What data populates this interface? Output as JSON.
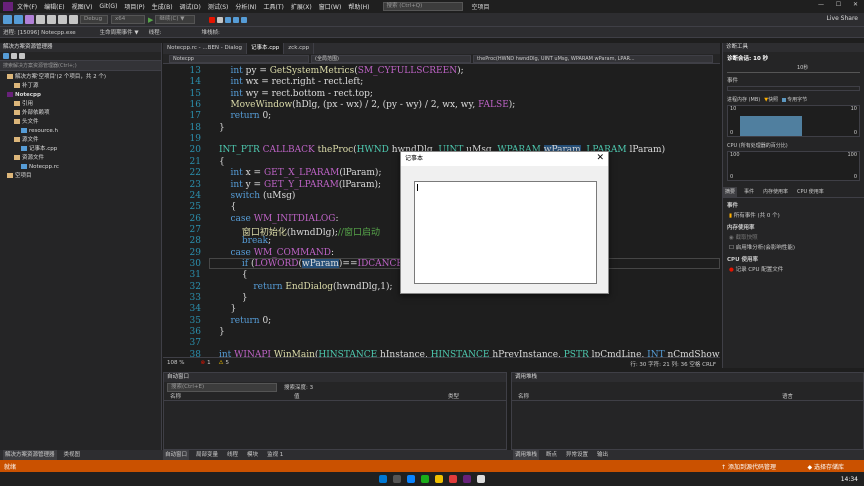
{
  "menu": {
    "items": [
      "文件(F)",
      "编辑(E)",
      "视图(V)",
      "Git(G)",
      "项目(P)",
      "生成(B)",
      "调试(D)",
      "测试(S)",
      "分析(N)",
      "工具(T)",
      "扩展(X)",
      "窗口(W)",
      "帮助(H)"
    ],
    "search_placeholder": "搜索 (Ctrl+Q)",
    "project_name": "空项目",
    "live_share": "Live Share"
  },
  "toolbar": {
    "config": "Debug",
    "platform": "x64",
    "continue": "继续(C) ▼"
  },
  "procbar": {
    "process": "进程: [15096] Notecpp.exe",
    "lifecycle": "生命周期事件 ▼",
    "thread": "线程:",
    "stackframe": "堆栈帧:"
  },
  "solution_explorer": {
    "title": "解决方案资源管理器",
    "search_placeholder": "搜索解决方案资源管理器(Ctrl+;)",
    "items": [
      {
        "label": "解决方案'空项目'(2 个项目，共 2 个)",
        "indent": 1
      },
      {
        "label": "补丁源",
        "indent": 2
      },
      {
        "label": "Notecpp",
        "indent": 1
      },
      {
        "label": "引用",
        "indent": 2
      },
      {
        "label": "外部依赖项",
        "indent": 2
      },
      {
        "label": "头文件",
        "indent": 2
      },
      {
        "label": "resource.h",
        "indent": 3
      },
      {
        "label": "源文件",
        "indent": 2
      },
      {
        "label": "记事本.cpp",
        "indent": 3
      },
      {
        "label": "资源文件",
        "indent": 2
      },
      {
        "label": "Notecpp.rc",
        "indent": 3
      },
      {
        "label": "空项目",
        "indent": 1
      }
    ]
  },
  "editor": {
    "tabs": [
      "Notecpp.rc - ...BEN - Dialog",
      "记事本.cpp",
      "zck.cpp"
    ],
    "active_tab": 1,
    "nav": [
      "Notecpp",
      "(全局范围)",
      "theProc(HWND hwndDlg, UINT uMsg, WPARAM wParam, LPAR..."
    ],
    "lines": [
      {
        "n": "13",
        "html": "    <span class='kw'>int</span> py = <span class='fn'>GetSystemMetrics</span>(<span class='mac'>SM_CYFULLSCREEN</span>);"
      },
      {
        "n": "14",
        "html": "    <span class='kw'>int</span> wx = rect.right - rect.left;"
      },
      {
        "n": "15",
        "html": "    <span class='kw'>int</span> wy = rect.bottom - rect.top;"
      },
      {
        "n": "16",
        "html": "    <span class='fn'>MoveWindow</span>(hDlg, (px - wx) / 2, (py - wy) / 2, wx, wy, <span class='mac'>FALSE</span>);"
      },
      {
        "n": "17",
        "html": "    <span class='kw'>return</span> 0;"
      },
      {
        "n": "18",
        "html": "}"
      },
      {
        "n": "19",
        "html": ""
      },
      {
        "n": "20",
        "html": "<span class='ty'>INT_PTR</span> <span class='mac'>CALLBACK</span> <span class='fn'>theProc</span>(<span class='ty'>HWND</span> hwndDlg, <span class='ty'>UINT</span> uMsg, <span class='ty'>WPARAM</span> <span class='hl'>wParam</span>, <span class='ty'>LPARAM</span> lParam)"
      },
      {
        "n": "21",
        "html": "{"
      },
      {
        "n": "22",
        "html": "    <span class='kw'>int</span> x = <span class='mac'>GET_X_LPARAM</span>(lParam);"
      },
      {
        "n": "23",
        "html": "    <span class='kw'>int</span> y = <span class='mac'>GET_Y_LPARAM</span>(lParam);"
      },
      {
        "n": "24",
        "html": "    <span class='kw'>switch</span> (uMsg)"
      },
      {
        "n": "25",
        "html": "    {"
      },
      {
        "n": "26",
        "html": "    <span class='kw'>case</span> <span class='mac'>WM_INITDIALOG</span>:"
      },
      {
        "n": "27",
        "html": "        <span class='fn'>窗口初始化</span>(hwndDlg);<span class='cm'>//窗口启动</span>"
      },
      {
        "n": "28",
        "html": "        <span class='kw'>break</span>;"
      },
      {
        "n": "29",
        "html": "    <span class='kw'>case</span> <span class='mac'>WM_COMMAND</span>:"
      },
      {
        "n": "30",
        "html": "        <span class='kw'>if</span> (<span class='mac'>LOWORD</span>(<span class='hl'>wParam</span>)==<span class='mac'>IDCANCEL</span>)"
      },
      {
        "n": "31",
        "html": "        {"
      },
      {
        "n": "32",
        "html": "            <span class='kw'>return</span> <span class='fn'>EndDialog</span>(hwndDlg,1);"
      },
      {
        "n": "33",
        "html": "        }"
      },
      {
        "n": "34",
        "html": "    }"
      },
      {
        "n": "35",
        "html": "    <span class='kw'>return</span> 0;"
      },
      {
        "n": "36",
        "html": "}"
      },
      {
        "n": "37",
        "html": ""
      },
      {
        "n": "38",
        "html": "<span class='kw'>int</span> <span class='mac'>WINAPI</span> <span class='fn'>WinMain</span>(<span class='ty'>HINSTANCE</span> hInstance, <span class='ty'>HINSTANCE</span> hPrevInstance, <span class='ty'>PSTR</span> lpCmdLine, <span class='kw'>INT</span> nCmdShow)"
      }
    ],
    "zoom": "108 %",
    "errors": "1",
    "warnings": "5",
    "position": "行: 30    字符: 21    列: 36    空格    CRLF"
  },
  "diag": {
    "title": "诊断工具",
    "session": "诊断会话: 10 秒",
    "timeline_label": "10秒",
    "events": "事件",
    "memory_title": "进程内存 (MB)",
    "memory_legend": [
      "快照",
      "专用字节"
    ],
    "mem_max": "10",
    "mem_min": "0",
    "cpu_title": "CPU (所有处理器的百分比)",
    "cpu_max": "100",
    "cpu_min": "0",
    "tabs": [
      "摘要",
      "事件",
      "内存使用率",
      "CPU 使用率"
    ],
    "events_header": "事件",
    "events_text": "所有事件 (共 0 个)",
    "mem_usage_header": "内存使用率",
    "snapshot": "截取快照",
    "heap": "启用堆分析(会影响性能)",
    "cpu_usage_header": "CPU 使用率",
    "cpu_profile": "记录 CPU 配置文件"
  },
  "autos": {
    "title": "自动窗口",
    "search_placeholder": "搜索(Ctrl+E)",
    "search_depth": "搜索深度: 3",
    "cols": [
      "名称",
      "值",
      "类型"
    ]
  },
  "callstack": {
    "title": "调用堆栈",
    "cols": [
      "名称",
      "语言"
    ]
  },
  "bottom_tabs_left": [
    "自动窗口",
    "局部变量",
    "线程",
    "模块",
    "监视 1"
  ],
  "bottom_tabs_right": [
    "调用堆栈",
    "断点",
    "异常设置",
    "输出"
  ],
  "status": {
    "ready": "就绪",
    "left_tabs": [
      "解决方案资源管理器",
      "类视图"
    ],
    "add_source": "添加到源代码管理",
    "select_repo": "选择存储库"
  },
  "dialog": {
    "title": "记事本",
    "close": "✕"
  },
  "taskbar": {
    "time": "14:34"
  },
  "colors": {
    "status_bar": "#ca5100",
    "accent": "#007acc"
  }
}
